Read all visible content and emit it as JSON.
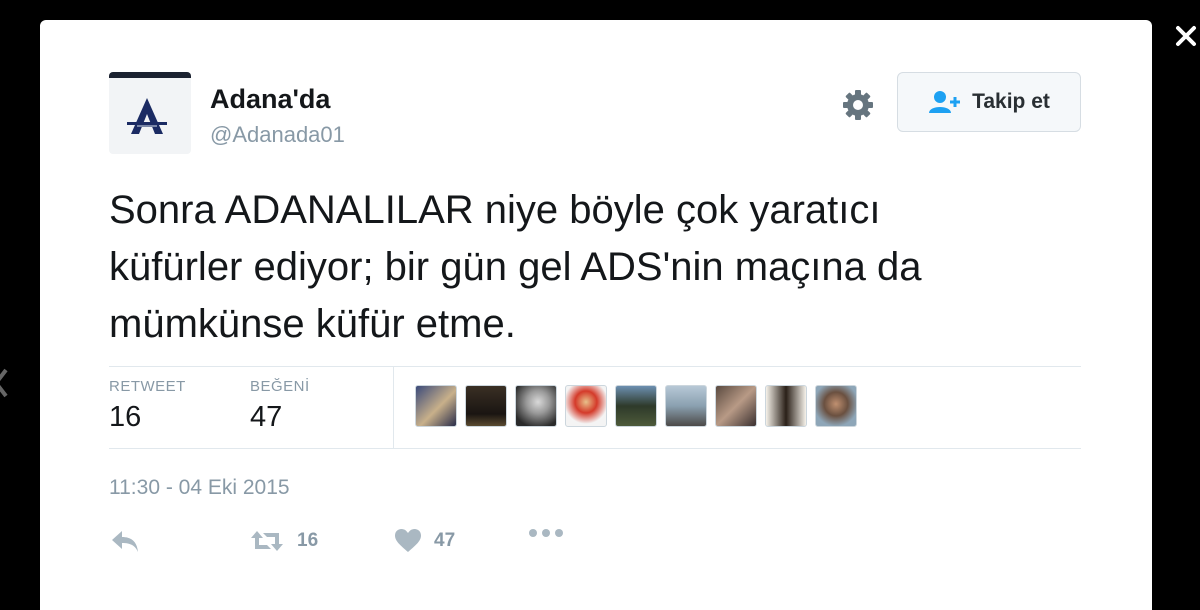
{
  "profile": {
    "display_name": "Adana'da",
    "handle": "@Adanada01"
  },
  "follow_button": {
    "label": "Takip et"
  },
  "tweet": {
    "lines": [
      "Sonra ADANALILAR niye böyle çok yaratıcı",
      "küfürler ediyor; bir gün gel ADS'nin maçına da",
      "mümkünse küfür etme."
    ]
  },
  "stats": {
    "retweet_label": "RETWEET",
    "retweet_count": "16",
    "like_label": "BEĞENİ",
    "like_count": "47"
  },
  "timestamp": "11:30 - 04 Eki 2015",
  "actions": {
    "retweet_count": "16",
    "like_count": "47"
  },
  "likers_count": 9,
  "colors": {
    "background": "#000000",
    "card": "#ffffff",
    "text": "#14171a",
    "muted": "#8899a6",
    "follow_icon": "#1da1f2",
    "avatar_logo": "#1b2b63"
  },
  "icons": [
    "close-icon",
    "chevron-left-icon",
    "gear-icon",
    "follow-user-icon",
    "reply-icon",
    "retweet-icon",
    "heart-icon",
    "more-icon"
  ]
}
